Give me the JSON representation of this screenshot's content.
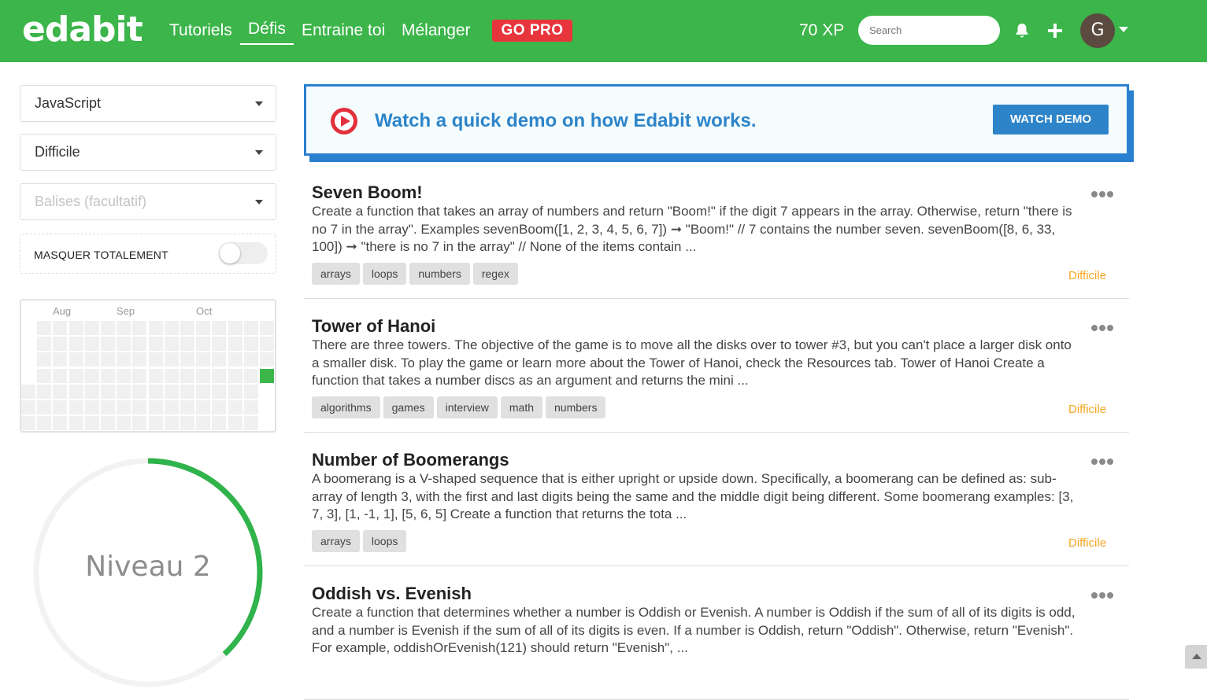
{
  "header": {
    "logo": "edabit",
    "nav": [
      {
        "label": "Tutoriels"
      },
      {
        "label": "Défis"
      },
      {
        "label": "Entraine toi"
      },
      {
        "label": "Mélanger"
      }
    ],
    "gopro_label": "GO PRO",
    "xp": "70 XP",
    "search_placeholder": "Search",
    "avatar_letter": "G",
    "colors": {
      "bar": "#3cb54a",
      "gopro": "#e8353b"
    }
  },
  "sidebar": {
    "language": "JavaScript",
    "difficulty": "Difficile",
    "tags_placeholder": "Balises (facultatif)",
    "hide_label": "MASQUER TOTALEMENT",
    "hide_enabled": false,
    "heatmap_months": [
      "Aug",
      "Sep",
      "Oct"
    ],
    "level_label": "Niveau 2",
    "level_progress": 0.38
  },
  "banner": {
    "text": "Watch a quick demo on how Edabit works.",
    "button": "WATCH DEMO"
  },
  "challenges": [
    {
      "title": "Seven Boom!",
      "description": "Create a function that takes an array of numbers and return \"Boom!\" if the digit 7 appears in the array. Otherwise, return \"there is no 7 in the array\". Examples sevenBoom([1, 2, 3, 4, 5, 6, 7]) ➞ \"Boom!\" // 7 contains the number seven. sevenBoom([8, 6, 33, 100]) ➞ \"there is no 7 in the array\" // None of the items contain ...",
      "tags": [
        "arrays",
        "loops",
        "numbers",
        "regex"
      ],
      "difficulty": "Difficile"
    },
    {
      "title": "Tower of Hanoi",
      "description": "There are three towers. The objective of the game is to move all the disks over to tower #3, but you can't place a larger disk onto a smaller disk. To play the game or learn more about the Tower of Hanoi, check the Resources tab. Tower of Hanoi Create a function that takes a number discs as an argument and returns the mini ...",
      "tags": [
        "algorithms",
        "games",
        "interview",
        "math",
        "numbers"
      ],
      "difficulty": "Difficile"
    },
    {
      "title": "Number of Boomerangs",
      "description": "A boomerang is a V-shaped sequence that is either upright or upside down. Specifically, a boomerang can be defined as: sub-array of length 3, with the first and last digits being the same and the middle digit being different. Some boomerang examples: [3, 7, 3], [1, -1, 1], [5, 6, 5] Create a function that returns the tota ...",
      "tags": [
        "arrays",
        "loops"
      ],
      "difficulty": "Difficile"
    },
    {
      "title": "Oddish vs. Evenish",
      "description": "Create a function that determines whether a number is Oddish or Evenish. A number is Oddish if the sum of all of its digits is odd, and a number is Evenish if the sum of all of its digits is even. If a number is Oddish, return \"Oddish\". Otherwise, return \"Evenish\". For example, oddishOrEvenish(121) should return \"Evenish\", ...",
      "tags": [],
      "difficulty": ""
    }
  ]
}
